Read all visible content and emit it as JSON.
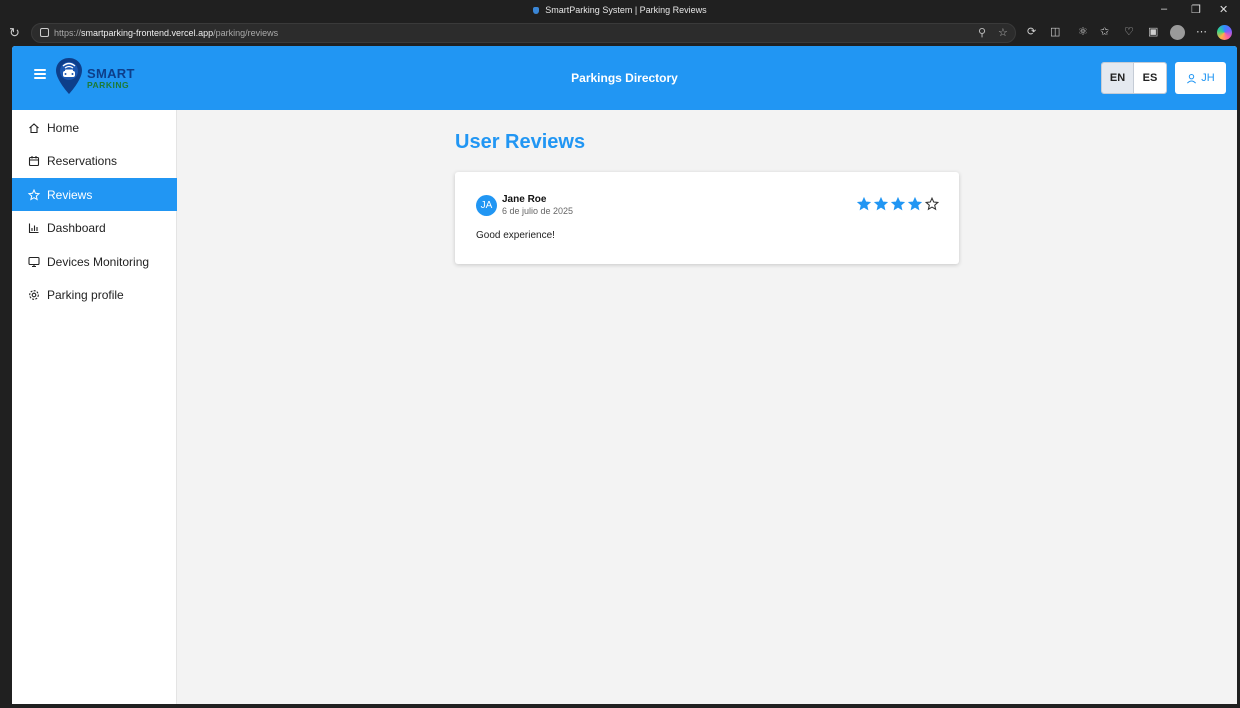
{
  "browser": {
    "tab_title": "SmartParking System | Parking Reviews",
    "url_prefix": "https://",
    "url_host": "smartparking-frontend.vercel.app",
    "url_path": "/parking/reviews"
  },
  "header": {
    "brand_line1": "SMART",
    "brand_line2": "PARKING",
    "title": "Parkings Directory",
    "languages": [
      {
        "label": "EN",
        "active": true
      },
      {
        "label": "ES",
        "active": false
      }
    ],
    "user_initials": "JH"
  },
  "sidebar": {
    "items": [
      {
        "label": "Home",
        "icon": "home-icon",
        "active": false
      },
      {
        "label": "Reservations",
        "icon": "calendar-icon",
        "active": false
      },
      {
        "label": "Reviews",
        "icon": "star-icon",
        "active": true
      },
      {
        "label": "Dashboard",
        "icon": "bar-chart-icon",
        "active": false
      },
      {
        "label": "Devices Monitoring",
        "icon": "monitor-icon",
        "active": false
      },
      {
        "label": "Parking profile",
        "icon": "gear-icon",
        "active": false
      }
    ]
  },
  "main": {
    "title": "User Reviews",
    "reviews": [
      {
        "initials": "JA",
        "name": "Jane Roe",
        "date": "6 de julio de 2025",
        "rating": 4,
        "max_rating": 5,
        "text": "Good experience!"
      }
    ]
  },
  "colors": {
    "primary": "#2196f3",
    "background": "#f3f3f3",
    "brand_dark": "#0d3e8a",
    "brand_green": "#1d7a36"
  }
}
